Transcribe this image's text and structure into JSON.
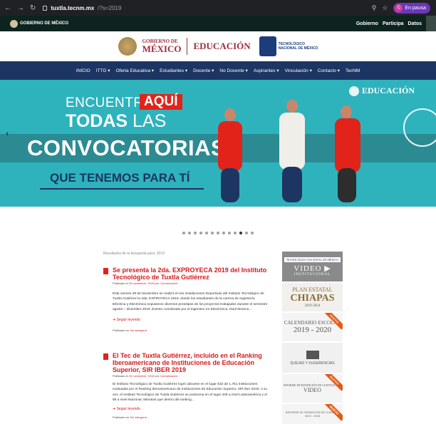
{
  "browser": {
    "host": "tuxtla.tecnm.mx",
    "path": "/?s=2019",
    "profile_initial": "C",
    "profile_label": "En pausa"
  },
  "govbar": {
    "logo_text": "GOBIERNO DE MÉXICO",
    "links": [
      "Gobierno",
      "Participa",
      "Datos"
    ]
  },
  "brand": {
    "gob_line1": "GOBIERNO DE",
    "gob_line2": "MÉXICO",
    "educacion": "EDUCACIÓN",
    "tec_line1": "TECNOLÓGICO",
    "tec_line2": "NACIONAL DE MÉXICO"
  },
  "nav": {
    "items": [
      "INICIO",
      "ITTG",
      "Oferta Educativa",
      "Estudiantes",
      "Docente",
      "No Docente",
      "Aspirantes",
      "Vinculación",
      "Contacto",
      "TecNM"
    ]
  },
  "hero": {
    "line1": "ENCUENTRA",
    "aqui": "AQUÍ",
    "line2_bold": "TODAS",
    "line2_light": "LAS",
    "line3": "CONVOCATORIAS",
    "line4": "QUE TENEMOS PARA TÍ",
    "corner_brand": "EDUCACIÓN"
  },
  "carousel": {
    "dot_count": 13,
    "active_index": 10
  },
  "results_label": "Resultados de la búsqueda para: 2019",
  "posts": [
    {
      "title": "Se presenta la 2da. EXPROYECA 2019 del Instituto Tecnológico de Tuxtla Gutiérrez",
      "published_prefix": "Publicado el",
      "date": "25 noviembre, 2019",
      "by": "por",
      "author": "Comunicación",
      "body": "Este viernes 29 de Noviembre se realizó en las instalaciones Deportivas del Instituto Tecnológico de Tuxtla Gutiérrez la 2da. EXPROYECA 2019, donde los estudiantes de la carrera de Ingeniería Eléctrica y Electrónica expusieron diversos prototipos de los proyectos trabajados durante el semestre agosto – diciembre 2019. Evento coordinado por el ingeniero en Electrónica, Raúl Moreno…",
      "more": "Seguir leyendo",
      "cat_prefix": "Publicado en",
      "category": "Sin categoría"
    },
    {
      "title": "El Tec de Tuxtla Gutiérrez, incluido en el Ranking Iberoamericano de Instituciones de Educación Superior, SIR IBER 2019",
      "published_prefix": "Publicado el",
      "date": "25 noviembre, 2019",
      "by": "por",
      "author": "Comunicación",
      "body": "El Instituto Tecnológico de Tuxtla Gutiérrez logró ubicarse en el lugar 532 de 1,761 Instituciones evaluadas por el Ranking Iberoamericano de Instituciones de Educación Superior, SIR Iber 2019. A su vez, el Instituto Tecnológico de Tuxtla Gutiérrez se posiciona en el lugar 435 a nivel Latinoamérica y el 88 a nivel Nacional. Mientras que dentro del ranking…",
      "more": "Seguir leyendo",
      "cat_prefix": "Publicado en",
      "category": "Sin categoría"
    }
  ],
  "sidebar": {
    "video_small": "TECNOLÓGICO NACIONAL DE MÉXICO",
    "video_big": "VIDEO",
    "video_inst": "INSTITUCIONAL",
    "plan_a": "PLAN ESTATAL",
    "plan_b": "CHIAPAS",
    "plan_c": "2019-2024",
    "cal_a": "CALENDARIO ESCOLAR",
    "cal_b": "2019 - 2020",
    "quejas": "QUEJAS Y SUGERENCIAS",
    "informe_a": "INFORME DE RENDICIÓN DE CUENTAS 2017",
    "informe_b": "VIDEO",
    "informe2": "INFORME DE RENDICIÓN DE CUENTAS 2013 - 2018",
    "nuevo": "NUEVO"
  }
}
